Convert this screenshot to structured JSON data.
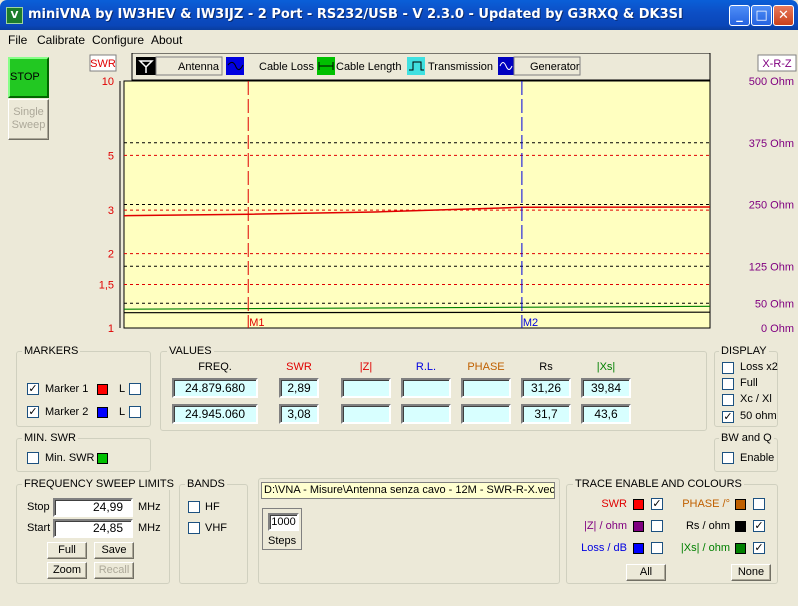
{
  "window": {
    "title": "miniVNA by IW3HEV & IW3IJZ - 2 Port - RS232/USB - V 2.3.0 - Updated by G3RXQ & DK3SI",
    "app_icon": "miniVNA-icon",
    "controls": {
      "minimize": "_",
      "maximize": "□",
      "close": "✕"
    }
  },
  "menu": [
    "File",
    "Calibrate",
    "Configure",
    "About"
  ],
  "buttons": {
    "stop": "STOP",
    "single_sweep": "Single Sweep"
  },
  "mode_tabs": [
    {
      "label": "Antenna",
      "icon": "antenna-icon"
    },
    {
      "label": "Cable Loss",
      "icon": "cable-loss-icon"
    },
    {
      "label": "Cable Length",
      "icon": "cable-length-icon"
    },
    {
      "label": "Transmission",
      "icon": "transmission-icon"
    },
    {
      "label": "Generator",
      "icon": "generator-icon"
    }
  ],
  "chart": {
    "left_axis_title": "SWR",
    "right_axis_title": "X-R-Z",
    "left_ticks": [
      "10",
      "5",
      "3",
      "2",
      "1,5",
      "1"
    ],
    "right_ticks": [
      "500 Ohm",
      "375 Ohm",
      "250 Ohm",
      "125 Ohm",
      "50 Ohm",
      "0 Ohm"
    ],
    "markers": [
      "M1",
      "M2"
    ],
    "colors": {
      "plot_bg": "#ffffc0",
      "swr": "#e00000",
      "xs": "#008000",
      "rs": "#000000",
      "marker1": "#e00000",
      "marker2": "#0000e0",
      "right_axis": "#800080"
    }
  },
  "chart_data": {
    "type": "line",
    "ylabel": "SWR",
    "y2label": "X-R-Z",
    "ylim": [
      1,
      10
    ],
    "y2lim": [
      0,
      500
    ],
    "y_scale": "log",
    "x_range_mhz": [
      24.85,
      24.99
    ],
    "markers": [
      {
        "name": "M1",
        "x": 24.87968
      },
      {
        "name": "M2",
        "x": 24.94506
      }
    ],
    "series": [
      {
        "name": "SWR",
        "axis": "left",
        "x": [
          24.85,
          24.88,
          24.91,
          24.945,
          24.99
        ],
        "values": [
          2.85,
          2.89,
          2.95,
          3.08,
          3.09
        ]
      },
      {
        "name": "Rs",
        "axis": "right",
        "x": [
          24.85,
          24.99
        ],
        "values": [
          31,
          32
        ]
      },
      {
        "name": "|Xs|",
        "axis": "right",
        "x": [
          24.85,
          24.99
        ],
        "values": [
          38,
          44
        ]
      }
    ]
  },
  "markers_group": {
    "title": "MARKERS",
    "marker1": "Marker 1",
    "marker2": "Marker 2",
    "l": "L"
  },
  "values_group": {
    "title": "VALUES",
    "headers": [
      "FREQ.",
      "SWR",
      "|Z|",
      "R.L.",
      "PHASE",
      "Rs",
      "|Xs|"
    ],
    "rows": [
      [
        "24.879.680",
        "2,89",
        "",
        "",
        "",
        "31,26",
        "39,84"
      ],
      [
        "24.945.060",
        "3,08",
        "",
        "",
        "",
        "31,7",
        "43,6"
      ]
    ]
  },
  "display_group": {
    "title": "DISPLAY",
    "options": [
      {
        "label": "Loss x2",
        "checked": false
      },
      {
        "label": "Full",
        "checked": false
      },
      {
        "label": "Xc / Xl",
        "checked": false
      },
      {
        "label": "50 ohm",
        "checked": true
      }
    ]
  },
  "min_swr": {
    "title": "MIN. SWR",
    "label": "Min. SWR"
  },
  "bwq": {
    "title": "BW and Q",
    "label": "Enable"
  },
  "sweep": {
    "title": "FREQUENCY SWEEP LIMITS",
    "stop_label": "Stop",
    "stop_value": "24,99",
    "start_label": "Start",
    "start_value": "24,85",
    "unit": "MHz",
    "full": "Full",
    "save": "Save",
    "zoom": "Zoom",
    "recall": "Recall"
  },
  "bands": {
    "title": "BANDS",
    "hf": "HF",
    "vhf": "VHF"
  },
  "file_path": "D:\\VNA - Misure\\Antenna senza cavo - 12M - SWR-R-X.vec",
  "steps": {
    "value": "1000",
    "label": "Steps"
  },
  "trace": {
    "title": "TRACE ENABLE AND COLOURS",
    "left": [
      {
        "label": "SWR",
        "color": "#ff0000",
        "checked": true
      },
      {
        "label": "|Z| / ohm",
        "color": "#800080",
        "checked": false
      },
      {
        "label": "Loss / dB",
        "color": "#0000ff",
        "checked": false
      }
    ],
    "right": [
      {
        "label": "PHASE /°",
        "color": "#c06000",
        "checked": false
      },
      {
        "label": "Rs / ohm",
        "color": "#000000",
        "checked": true
      },
      {
        "label": "|Xs| / ohm",
        "color": "#008000",
        "checked": true
      }
    ],
    "all": "All",
    "none": "None"
  }
}
